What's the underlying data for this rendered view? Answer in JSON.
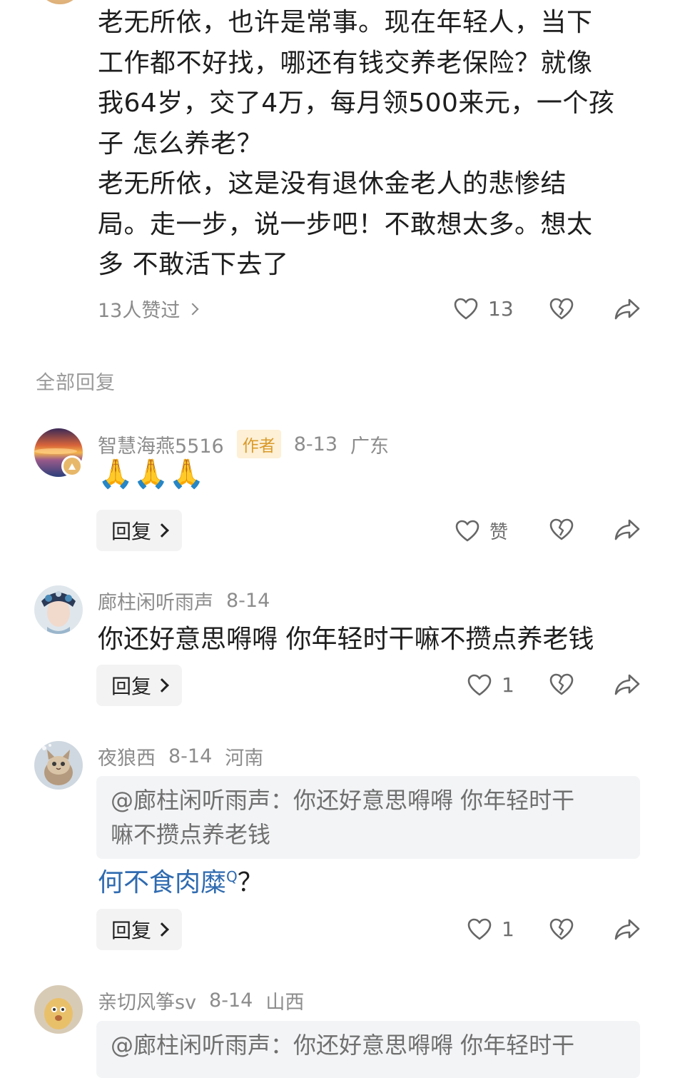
{
  "main_comment": {
    "lines": [
      "老无所依，也许是常事。现在年轻人，当下",
      "工作都不好找，哪还有钱交养老保险？就像",
      "我64岁，交了4万，每月领500来元，一个孩",
      "子 怎么养老？",
      "老无所依，这是没有退休金老人的悲惨结",
      "局。走一步，说一步吧！不敢想太多。想太",
      "多 不敢活下去了"
    ],
    "likers_label": "13人赞过",
    "like_count": "13"
  },
  "section_title": "全部回复",
  "replies": [
    {
      "name": "智慧海燕5516",
      "tag": "作者",
      "date": "8-13",
      "location": "广东",
      "text": "🙏🙏🙏",
      "reply_label": "回复",
      "like_label": "赞"
    },
    {
      "name": "廊柱闲听雨声",
      "date": "8-14",
      "text": "你还好意思嘚嘚 你年轻时干嘛不攒点养老钱",
      "reply_label": "回复",
      "like_count": "1"
    },
    {
      "name": "夜狼西",
      "date": "8-14",
      "location": "河南",
      "quote_line1": "@廊柱闲听雨声：你还好意思嘚嘚 你年轻时干",
      "quote_line2": "嘛不攒点养老钱",
      "text_link": "何不食肉糜",
      "search_mark": "Q",
      "text_suffix": "？",
      "reply_label": "回复",
      "like_count": "1"
    },
    {
      "name": "亲切风筝sv",
      "date": "8-14",
      "location": "山西",
      "quote_line1": "@廊柱闲听雨声：你还好意思嘚嘚 你年轻时干"
    }
  ]
}
